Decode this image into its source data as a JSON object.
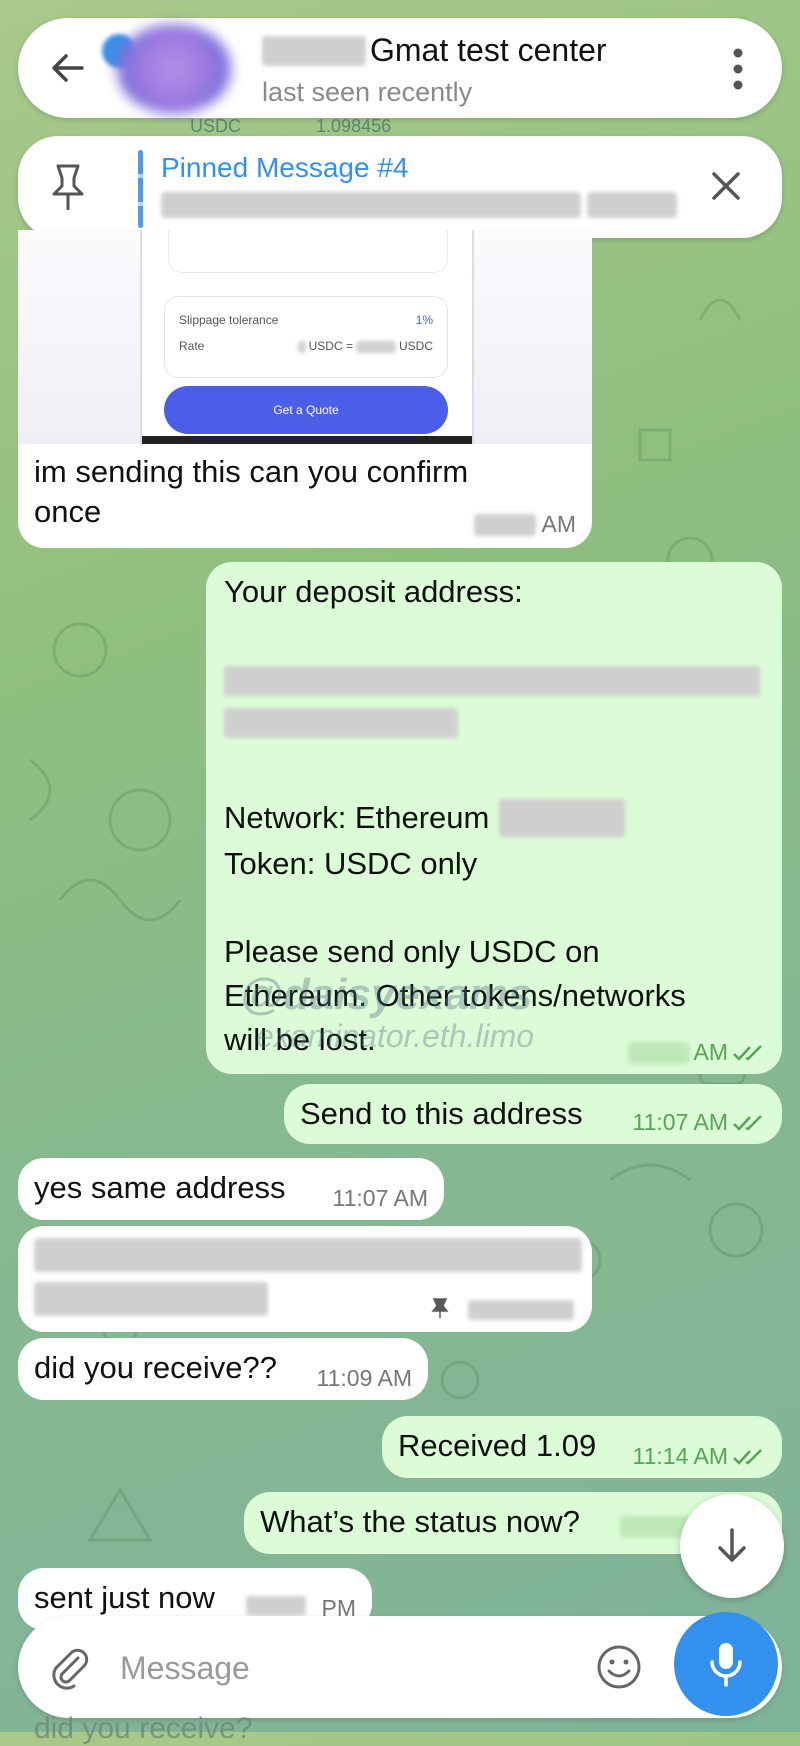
{
  "header": {
    "title": "Gmat test center",
    "status": "last seen recently",
    "peek_value": "1.098456",
    "peek_token": "USDC"
  },
  "pinned": {
    "title": "Pinned Message #4"
  },
  "image_preview": {
    "slippage_label": "Slippage tolerance",
    "slippage_value": "1%",
    "rate_label": "Rate",
    "rate_value_a": "USDC =",
    "rate_value_b": "USDC",
    "button_label": "Get a Quote"
  },
  "messages": [
    {
      "id": "m1",
      "dir": "in",
      "text": "im sending this can you confirm once",
      "time": "AM"
    },
    {
      "id": "m2",
      "dir": "out",
      "lines": [
        "Your deposit address:",
        "",
        "",
        "",
        "",
        "Network: Ethereum",
        "Token: USDC only",
        "",
        "Please send only USDC on",
        "Ethereum. Other tokens/networks",
        "will be lost."
      ],
      "time": "AM"
    },
    {
      "id": "m3",
      "dir": "out",
      "text": "Send to this address",
      "time": "11:07 AM"
    },
    {
      "id": "m4",
      "dir": "in",
      "text": "yes same address",
      "time": "11:07 AM"
    },
    {
      "id": "m5",
      "dir": "in",
      "text": "",
      "time": ""
    },
    {
      "id": "m6",
      "dir": "in",
      "text": "did you receive??",
      "time": "11:09 AM"
    },
    {
      "id": "m7",
      "dir": "out",
      "text": "Received 1.09",
      "time": "11:14 AM"
    },
    {
      "id": "m8",
      "dir": "out",
      "text": "What’s the status now?",
      "time": ""
    },
    {
      "id": "m9",
      "dir": "in",
      "text": "sent just now",
      "time": "PM"
    }
  ],
  "watermark": {
    "handle": "@daisyexams",
    "site": "examinator.eth.limo"
  },
  "peek_bottom": "did you receive?",
  "composer": {
    "placeholder": "Message"
  },
  "colors": {
    "accent": "#3390ec",
    "out_bubble": "#dcfcd7",
    "in_bubble": "#ffffff",
    "out_time": "#57a453"
  }
}
